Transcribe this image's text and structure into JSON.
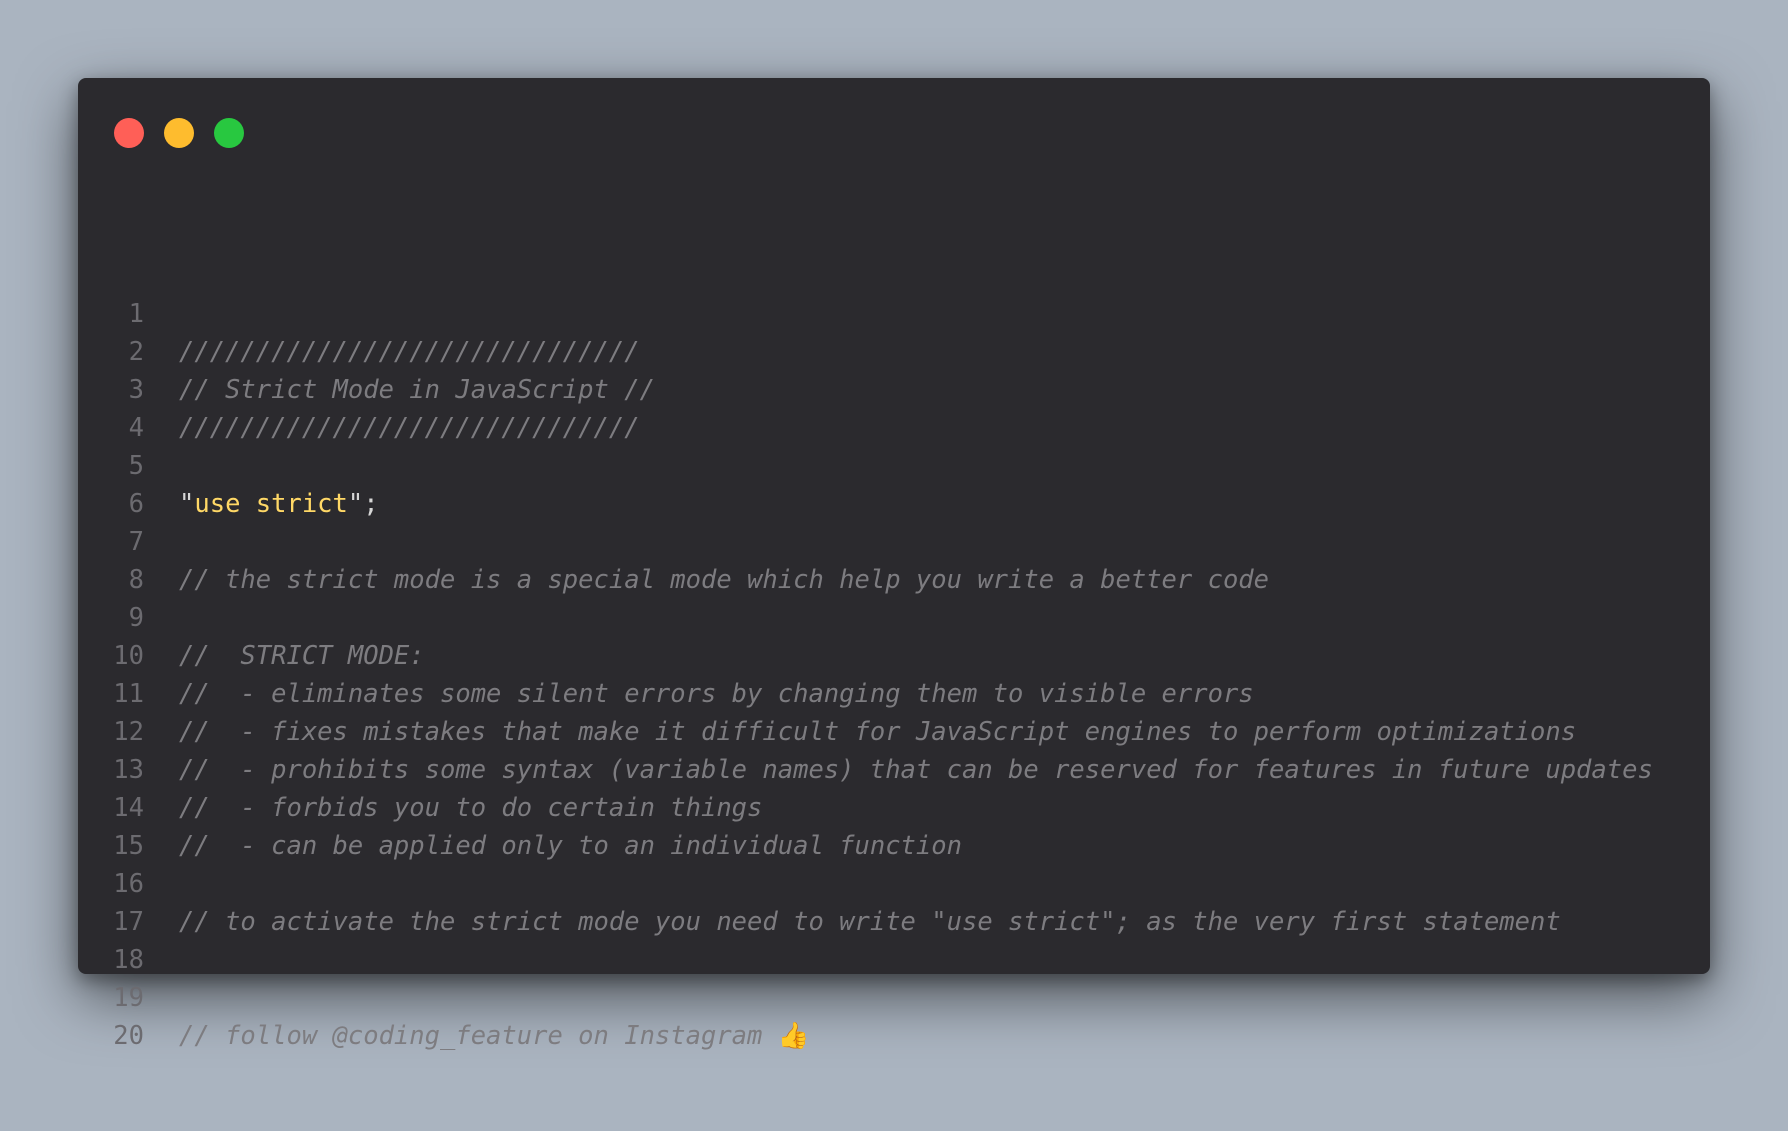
{
  "window": {
    "controls": [
      "close",
      "minimize",
      "maximize"
    ],
    "colors": {
      "background": "#2b2a2e",
      "close": "#ff5f57",
      "minimize": "#febc2e",
      "maximize": "#28c840",
      "string": "#ffd866",
      "comment": "#7d7c80",
      "line_number": "#6c6b70"
    }
  },
  "code": {
    "lines": [
      {
        "num": "1",
        "text": "//////////////////////////////"
      },
      {
        "num": "2",
        "text": "// Strict Mode in JavaScript //"
      },
      {
        "num": "3",
        "text": "//////////////////////////////"
      },
      {
        "num": "4",
        "text": ""
      },
      {
        "num": "5",
        "quote_open": "\"",
        "string": "use strict",
        "quote_close": "\"",
        "semicolon": ";"
      },
      {
        "num": "6",
        "text": ""
      },
      {
        "num": "7",
        "text": "// the strict mode is a special mode which help you write a better code"
      },
      {
        "num": "8",
        "text": ""
      },
      {
        "num": "9",
        "text": "//  STRICT MODE:"
      },
      {
        "num": "10",
        "text": "//  - eliminates some silent errors by changing them to visible errors"
      },
      {
        "num": "11",
        "text": "//  - fixes mistakes that make it difficult for JavaScript engines to perform optimizations"
      },
      {
        "num": "12",
        "text": "//  - prohibits some syntax (variable names) that can be reserved for features in future updates"
      },
      {
        "num": "13",
        "text": "//  - forbids you to do certain things"
      },
      {
        "num": "14",
        "text": "//  - can be applied only to an individual function"
      },
      {
        "num": "15",
        "text": ""
      },
      {
        "num": "16",
        "text": "// to activate the strict mode you need to write \"use strict\"; as the very first statement"
      },
      {
        "num": "17",
        "text": ""
      },
      {
        "num": "18",
        "text": ""
      },
      {
        "num": "19",
        "text": "// follow @coding_feature on Instagram ",
        "emoji": "👍"
      },
      {
        "num": "20",
        "text": ""
      }
    ]
  }
}
